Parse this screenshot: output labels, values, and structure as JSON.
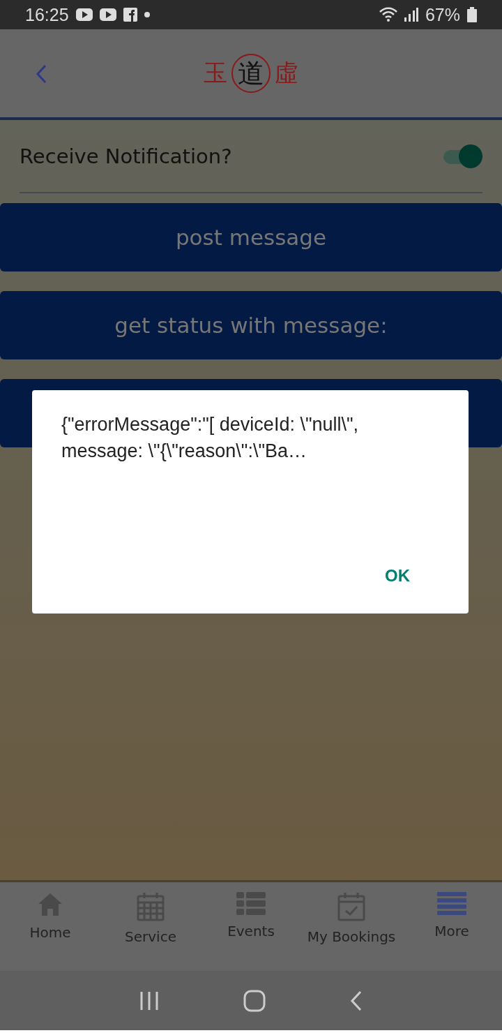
{
  "status_bar": {
    "time": "16:25",
    "battery": "67%"
  },
  "header": {
    "logo": {
      "left": "玉",
      "center": "道",
      "right": "虛"
    }
  },
  "notification": {
    "label": "Receive Notification?",
    "on": true
  },
  "buttons": [
    {
      "label": "post message"
    },
    {
      "label": "get status with message:"
    }
  ],
  "dialog": {
    "message": "{\"errorMessage\":\"[ deviceId: \\\"null\\\", message: \\\"{\\\"reason\\\":\\\"Ba…",
    "button": "OK"
  },
  "tabs": [
    {
      "label": "Home",
      "selected": false
    },
    {
      "label": "Service",
      "selected": false
    },
    {
      "label": "Events",
      "selected": false
    },
    {
      "label": "My Bookings",
      "selected": false
    },
    {
      "label": "More",
      "selected": true
    }
  ]
}
